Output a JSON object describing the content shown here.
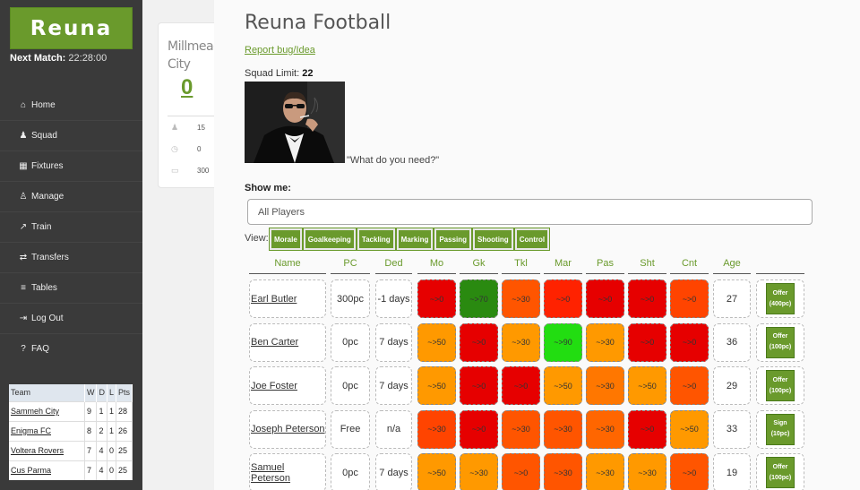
{
  "brand": "Reuna",
  "next_match": {
    "label": "Next Match:",
    "value": "22:28:00"
  },
  "nav": [
    {
      "label": "Home",
      "icon": "home-icon",
      "glyph": "⌂"
    },
    {
      "label": "Squad",
      "icon": "user-icon",
      "glyph": "♟"
    },
    {
      "label": "Fixtures",
      "icon": "calendar-icon",
      "glyph": "▦"
    },
    {
      "label": "Manage",
      "icon": "manage-icon",
      "glyph": "♙"
    },
    {
      "label": "Train",
      "icon": "chart-icon",
      "glyph": "↗"
    },
    {
      "label": "Transfers",
      "icon": "exchange-icon",
      "glyph": "⇄"
    },
    {
      "label": "Tables",
      "icon": "list-icon",
      "glyph": "≡"
    },
    {
      "label": "Log Out",
      "icon": "logout-icon",
      "glyph": "⇥"
    },
    {
      "label": "FAQ",
      "icon": "question-icon",
      "glyph": "?"
    }
  ],
  "league": {
    "headers": [
      "Team",
      "W",
      "D",
      "L",
      "Pts"
    ],
    "rows": [
      [
        "Sammeh City",
        "9",
        "1",
        "1",
        "28"
      ],
      [
        "Enigma FC",
        "8",
        "2",
        "1",
        "26"
      ],
      [
        "Voltera Rovers",
        "7",
        "4",
        "0",
        "25"
      ],
      [
        "Cus Parma",
        "7",
        "4",
        "0",
        "25"
      ]
    ]
  },
  "club": {
    "name": "Millmead City",
    "score": "0",
    "stats": [
      {
        "icon": "user-icon",
        "value": "15"
      },
      {
        "icon": "clock-icon",
        "value": "0"
      },
      {
        "icon": "money-icon",
        "value": "300"
      }
    ]
  },
  "page": {
    "title": "Reuna Football",
    "report_link": "Report bug/Idea",
    "squad_limit_label": "Squad Limit:",
    "squad_limit_value": "22",
    "quote": "\"What do you need?\"",
    "show_me": "Show me:",
    "select_value": "All Players",
    "view_label": "View:",
    "view_buttons": [
      "Morale",
      "Goalkeeping",
      "Tackling",
      "Marking",
      "Passing",
      "Shooting",
      "Control"
    ]
  },
  "table": {
    "headers": [
      "Name",
      "PC",
      "Ded",
      "Mo",
      "Gk",
      "Tkl",
      "Mar",
      "Pas",
      "Sht",
      "Cnt",
      "Age"
    ],
    "rows": [
      {
        "name": "Earl Butler",
        "pc": "300pc",
        "ded": "-1 days",
        "stats": [
          "~>0",
          "~>70",
          "~>30",
          "~>0",
          "~>0",
          "~>0",
          "~>0"
        ],
        "colors": [
          "#e60000",
          "#2a8a10",
          "#ff5500",
          "#ff2200",
          "#e60000",
          "#e60000",
          "#ff4400"
        ],
        "age": "27",
        "action": "Offer",
        "cost": "(400pc)"
      },
      {
        "name": "Ben Carter",
        "pc": "0pc",
        "ded": "7 days",
        "stats": [
          "~>50",
          "~>0",
          "~>30",
          "~>90",
          "~>30",
          "~>0",
          "~>0"
        ],
        "colors": [
          "#ff9900",
          "#e60000",
          "#ff9900",
          "#22dd11",
          "#ff9900",
          "#e60000",
          "#e60000"
        ],
        "age": "36",
        "action": "Offer",
        "cost": "(100pc)"
      },
      {
        "name": "Joe Foster",
        "pc": "0pc",
        "ded": "7 days",
        "stats": [
          "~>50",
          "~>0",
          "~>0",
          "~>50",
          "~>30",
          "~>50",
          "~>0"
        ],
        "colors": [
          "#ff9900",
          "#e60000",
          "#e60000",
          "#ff9900",
          "#ff7700",
          "#ff9900",
          "#ff5500"
        ],
        "age": "29",
        "action": "Offer",
        "cost": "(100pc)"
      },
      {
        "name": "Joseph Peterson",
        "pc": "Free",
        "ded": "n/a",
        "stats": [
          "~>30",
          "~>0",
          "~>30",
          "~>30",
          "~>30",
          "~>0",
          "~>50"
        ],
        "colors": [
          "#ff4400",
          "#e60000",
          "#ff5500",
          "#ff5500",
          "#ff6600",
          "#e60000",
          "#ff9900"
        ],
        "age": "33",
        "action": "Sign",
        "cost": "(10pc)"
      },
      {
        "name": "Samuel Peterson",
        "pc": "0pc",
        "ded": "7 days",
        "stats": [
          "~>50",
          "~>30",
          "~>0",
          "~>30",
          "~>30",
          "~>30",
          "~>0"
        ],
        "colors": [
          "#ff9900",
          "#ff9900",
          "#ff5500",
          "#ff5500",
          "#ff9900",
          "#ff9900",
          "#ff5500"
        ],
        "age": "19",
        "action": "Offer",
        "cost": "(100pc)"
      }
    ]
  },
  "colors": {
    "accent": "#6a9a2c",
    "sidebar": "#3a3a3a"
  }
}
